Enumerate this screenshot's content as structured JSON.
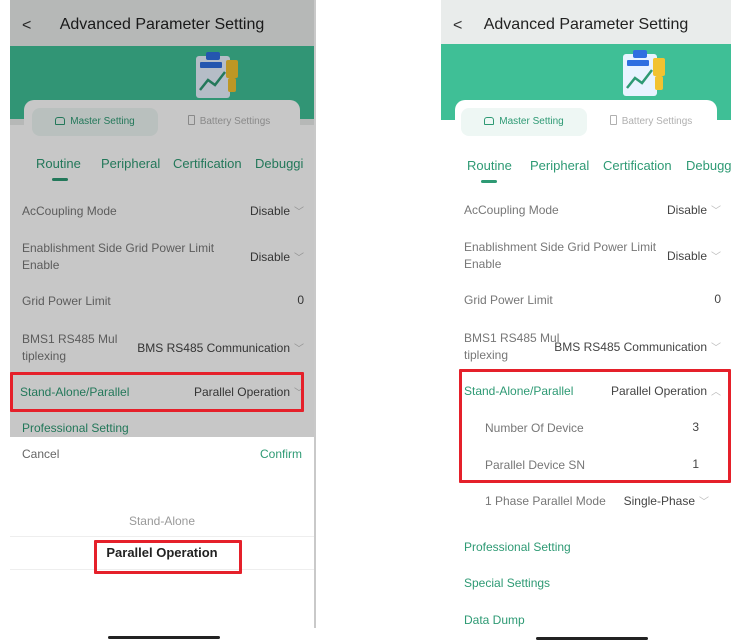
{
  "left": {
    "header": {
      "back": "<",
      "title": "Advanced Parameter Setting"
    },
    "segments": {
      "master": "Master Setting",
      "battery": "Battery Settings"
    },
    "tabs": [
      "Routine",
      "Peripheral",
      "Certification",
      "Debuggi"
    ],
    "rows": {
      "accoupling": {
        "label": "AcCoupling Mode",
        "value": "Disable"
      },
      "establish": {
        "label_line1": "Enablishment Side Grid Power Limit",
        "label_line2": "Enable",
        "value": "Disable"
      },
      "grid": {
        "label": "Grid Power Limit",
        "value": "0"
      },
      "bms": {
        "label_line1": "BMS1 RS485 Mul",
        "label_line2": "tiplexing",
        "value": "BMS RS485 Communication"
      },
      "standalone": {
        "label": "Stand-Alone/Parallel",
        "value": "Parallel Operation"
      }
    },
    "professional": "Professional Setting",
    "sheet": {
      "cancel": "Cancel",
      "confirm": "Confirm",
      "options": [
        "Stand-Alone",
        "Parallel Operation"
      ],
      "selected": "Parallel Operation"
    }
  },
  "right": {
    "header": {
      "back": "<",
      "title": "Advanced Parameter Setting"
    },
    "segments": {
      "master": "Master Setting",
      "battery": "Battery Settings"
    },
    "tabs": [
      "Routine",
      "Peripheral",
      "Certification",
      "Debuggi"
    ],
    "rows": {
      "accoupling": {
        "label": "AcCoupling Mode",
        "value": "Disable"
      },
      "establish": {
        "label_line1": "Enablishment Side Grid Power Limit",
        "label_line2": "Enable",
        "value": "Disable"
      },
      "grid": {
        "label": "Grid Power Limit",
        "value": "0"
      },
      "bms": {
        "label_line1": "BMS1 RS485 Mul",
        "label_line2": "tiplexing",
        "value": "BMS RS485 Communication"
      },
      "standalone": {
        "label": "Stand-Alone/Parallel",
        "value": "Parallel Operation"
      },
      "num_device": {
        "label": "Number Of Device",
        "value": "3"
      },
      "parallel_sn": {
        "label": "Parallel Device SN",
        "value": "1"
      },
      "phase_mode": {
        "label": "1 Phase Parallel Mode",
        "value": "Single-Phase"
      }
    },
    "links": [
      "Professional Setting",
      "Special Settings",
      "Data Dump"
    ]
  },
  "colors": {
    "accent": "#2e9a74",
    "teal": "#3fbf96",
    "highlight": "#e5202a"
  }
}
